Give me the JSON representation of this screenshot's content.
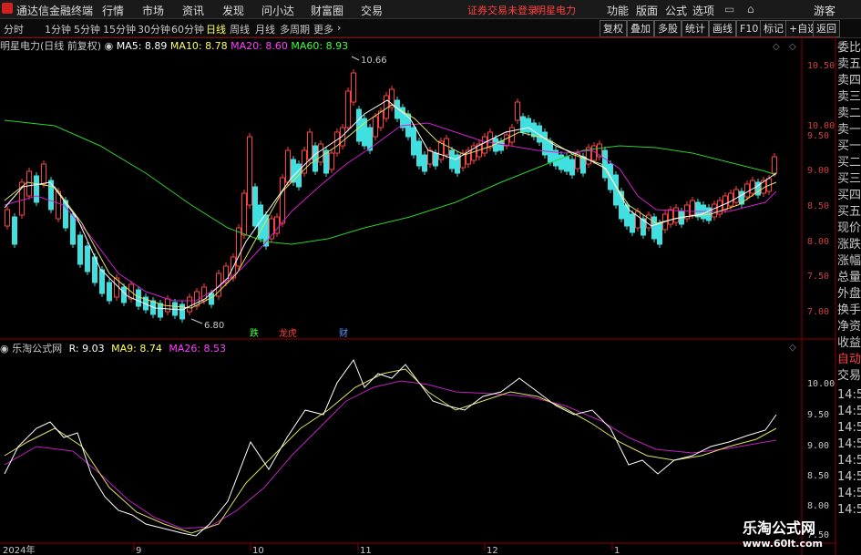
{
  "app": {
    "title": "通达信金融终端",
    "menu": [
      "行情",
      "市场",
      "资讯",
      "发现",
      "问小达",
      "财富圈",
      "交易"
    ],
    "notice": "证券交易未登录",
    "stock_name_top": "明星电力",
    "right_menu": [
      "功能",
      "版面",
      "公式",
      "选项"
    ],
    "guest": "游客"
  },
  "toolbar": {
    "periods": [
      "分时",
      "1分钟",
      "5分钟",
      "15分钟",
      "30分钟",
      "60分钟",
      "日线",
      "周线",
      "月线",
      "多周期",
      "更多"
    ],
    "active_period": "日线",
    "buttons": [
      "复权",
      "叠加",
      "多股",
      "统计",
      "画线",
      "F10",
      "标记",
      "+自选",
      "返回"
    ]
  },
  "price_chart": {
    "title": "明星电力(日线 前复权)",
    "ma": [
      {
        "label": "MA5: 8.89",
        "color": "#ffffff"
      },
      {
        "label": "MA10: 8.78",
        "color": "#ffff60"
      },
      {
        "label": "MA20: 8.60",
        "color": "#ff40ff"
      },
      {
        "label": "MA60: 8.93",
        "color": "#40ff40"
      }
    ],
    "y_ticks": [
      "10.50",
      "10.00",
      "9.50",
      "9.00",
      "8.50",
      "8.00",
      "7.50",
      "7.00"
    ],
    "high_label": "10.66",
    "low_label": "6.80",
    "markers": [
      {
        "text": "跌",
        "color": "#40ff40"
      },
      {
        "text": "龙虎",
        "color": "#ff4040"
      },
      {
        "text": "财",
        "color": "#6090ff"
      }
    ]
  },
  "indicator_chart": {
    "title": "乐淘公式网",
    "values": [
      {
        "label": "R: 9.03",
        "color": "#ffffff"
      },
      {
        "label": "MA9: 8.74",
        "color": "#ffff60"
      },
      {
        "label": "MA26: 8.53",
        "color": "#ff40ff"
      }
    ],
    "y_ticks": [
      "10.00",
      "9.50",
      "9.00",
      "8.50",
      "8.00",
      "7.50"
    ]
  },
  "x_axis": [
    "2024年",
    "9",
    "10",
    "11",
    "12",
    "1"
  ],
  "right_panel": [
    "委比",
    "卖五",
    "卖四",
    "卖三",
    "卖二",
    "卖一",
    "买一",
    "买二",
    "买三",
    "买四",
    "买五",
    "现价",
    "涨跌",
    "涨幅",
    "总量",
    "外盘",
    "换手",
    "净资",
    "收益",
    "自动",
    "交易",
    "14:5",
    "14:5",
    "14:5",
    "14:5",
    "14:5",
    "14:5",
    "14:5",
    "14:5"
  ],
  "watermark": {
    "line1": "乐淘公式网",
    "line2": "www.60lt.com"
  }
}
